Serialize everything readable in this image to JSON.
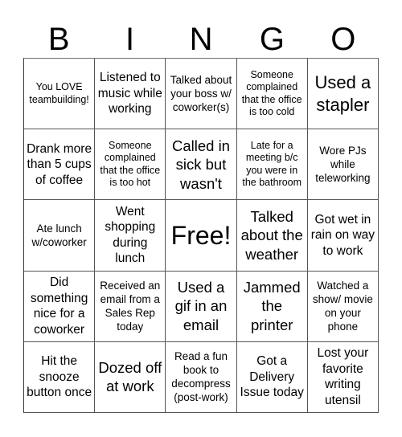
{
  "header": {
    "letters": [
      "B",
      "I",
      "N",
      "G",
      "O"
    ]
  },
  "cells": [
    {
      "text": "You LOVE teambuilding!",
      "size": "xs"
    },
    {
      "text": "Listened to music while working",
      "size": "m"
    },
    {
      "text": "Talked about your boss w/ coworker(s)",
      "size": "s"
    },
    {
      "text": "Someone complained that the office is too cold",
      "size": "xs"
    },
    {
      "text": "Used a stapler",
      "size": "xl"
    },
    {
      "text": "Drank more than 5 cups of coffee",
      "size": "m"
    },
    {
      "text": "Someone complained that the office is too hot",
      "size": "xs"
    },
    {
      "text": "Called in sick but wasn't",
      "size": "l"
    },
    {
      "text": "Late for a meeting b/c you were in the bathroom",
      "size": "xs"
    },
    {
      "text": "Wore PJs while teleworking",
      "size": "s"
    },
    {
      "text": "Ate lunch w/coworker",
      "size": "s"
    },
    {
      "text": "Went shopping during lunch",
      "size": "m"
    },
    {
      "text": "Free!",
      "size": "xxl"
    },
    {
      "text": "Talked about the weather",
      "size": "l"
    },
    {
      "text": "Got wet in rain on way to work",
      "size": "m"
    },
    {
      "text": "Did something nice for a coworker",
      "size": "m"
    },
    {
      "text": "Received an email from a Sales Rep today",
      "size": "s"
    },
    {
      "text": "Used a gif in an email",
      "size": "l"
    },
    {
      "text": "Jammed the printer",
      "size": "l"
    },
    {
      "text": "Watched a show/ movie on your phone",
      "size": "s"
    },
    {
      "text": "Hit the snooze button once",
      "size": "m"
    },
    {
      "text": "Dozed off at work",
      "size": "l"
    },
    {
      "text": "Read a fun book to decompress (post-work)",
      "size": "s"
    },
    {
      "text": "Got a Delivery Issue today",
      "size": "m"
    },
    {
      "text": "Lost your favorite writing utensil",
      "size": "m"
    }
  ]
}
